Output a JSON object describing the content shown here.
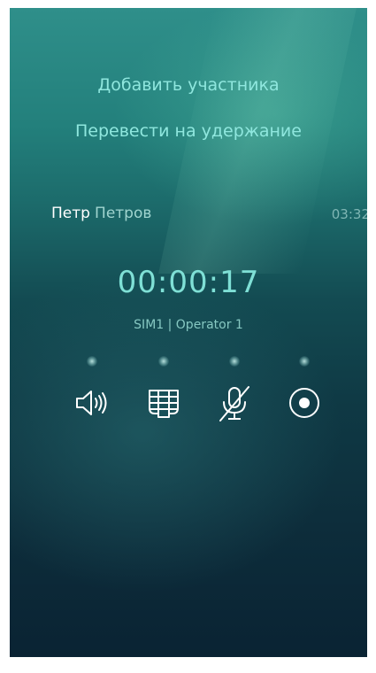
{
  "call": {
    "add_participant": "Добавить участника",
    "hold": "Перевести на удержание",
    "caller_first_name": "Петр",
    "caller_last_name": "Петров",
    "clock": "03:32",
    "duration": "00:00:17",
    "sim_info": "SIM1 | Operator 1"
  },
  "controls": [
    {
      "icon": "speaker-icon",
      "state": "off"
    },
    {
      "icon": "keypad-icon",
      "state": "off"
    },
    {
      "icon": "mute-microphone-icon",
      "state": "off"
    },
    {
      "icon": "record-icon",
      "state": "off"
    }
  ],
  "colors": {
    "accent": "#8fe7de",
    "background_top": "#2f8f8a",
    "background_bottom": "#0a2333"
  }
}
